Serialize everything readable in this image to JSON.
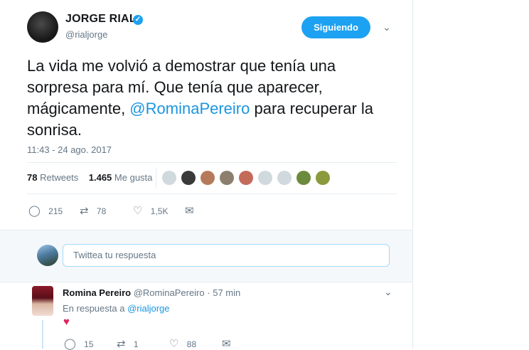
{
  "tweet": {
    "author_name": "JORGE RIAL",
    "verified_glyph": "✓",
    "author_handle": "@rialjorge",
    "follow_label": "Siguiendo",
    "text_before": "La vida me volvió a demostrar que tenía una sorpresa para mí. Que tenía que aparecer, mágicamente, ",
    "mention": "@RominaPereiro",
    "text_after": " para recuperar la sonrisa.",
    "timestamp": "11:43 - 24 ago. 2017",
    "retweets_count": "78",
    "retweets_label": "Retweets",
    "likes_count": "1.465",
    "likes_label": "Me gusta",
    "liker_colors": [
      "#cfd9de",
      "#3a3a3a",
      "#b57a5a",
      "#8c7f6e",
      "#c46a5a",
      "#cfd9de",
      "#cfd9de",
      "#6c8a3c",
      "#8a9a3c"
    ],
    "actions": {
      "replies": "215",
      "retweets": "78",
      "likes": "1,5K"
    },
    "icons": {
      "reply": "reply-icon",
      "retweet": "retweet-icon",
      "like": "heart-icon",
      "message": "message-icon",
      "chevron": "chevron-down-icon"
    }
  },
  "composer": {
    "placeholder": "Twittea tu respuesta"
  },
  "reply": {
    "name": "Romina Pereiro",
    "handle": "@RominaPereiro",
    "time": "57 min",
    "in_reply_prefix": "En respuesta a ",
    "in_reply_mention": "@rialjorge",
    "content_emoji": "♥",
    "actions": {
      "replies": "15",
      "retweets": "1",
      "likes": "88"
    }
  }
}
